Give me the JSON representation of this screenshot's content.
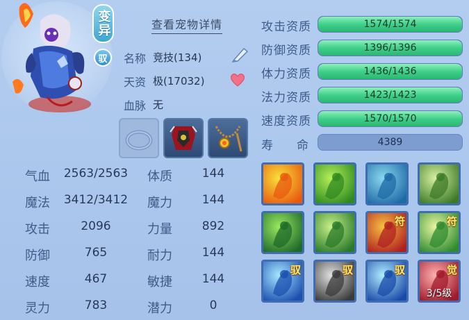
{
  "header": {
    "variant_tag": "变异",
    "tamed_tag": "驭",
    "detail_link": "查看宠物详情"
  },
  "info": {
    "name_label": "名称",
    "name_value": "竞技(134)",
    "talent_label": "天资",
    "talent_value": "极(17032)",
    "bloodline_label": "血脉",
    "bloodline_value": "无"
  },
  "equipment": [
    {
      "name": "collar-slot",
      "state": "empty"
    },
    {
      "name": "armor-slot",
      "state": "equipped"
    },
    {
      "name": "necklace-slot",
      "state": "equipped"
    }
  ],
  "attributes": [
    {
      "label": "气血",
      "value": "2563/2563",
      "label2": "体质",
      "value2": "144"
    },
    {
      "label": "魔法",
      "value": "3412/3412",
      "label2": "魔力",
      "value2": "144"
    },
    {
      "label": "攻击",
      "value": "2096",
      "label2": "力量",
      "value2": "892"
    },
    {
      "label": "防御",
      "value": "765",
      "label2": "耐力",
      "value2": "144"
    },
    {
      "label": "速度",
      "value": "467",
      "label2": "敏捷",
      "value2": "144"
    },
    {
      "label": "灵力",
      "value": "783",
      "label2": "潜力",
      "value2": "0"
    }
  ],
  "aptitudes": [
    {
      "label": "攻击资质",
      "value": "1574/1574",
      "fill": 1.0
    },
    {
      "label": "防御资质",
      "value": "1396/1396",
      "fill": 1.0
    },
    {
      "label": "体力资质",
      "value": "1436/1436",
      "fill": 1.0
    },
    {
      "label": "法力资质",
      "value": "1423/1423",
      "fill": 1.0
    },
    {
      "label": "速度资质",
      "value": "1570/1570",
      "fill": 1.0
    }
  ],
  "lifespan": {
    "label": "寿　　命",
    "value": "4389"
  },
  "skills": [
    {
      "icon": "flame-sword-icon",
      "badge": ""
    },
    {
      "icon": "green-strength-icon",
      "badge": ""
    },
    {
      "icon": "blue-spirit-icon",
      "badge": ""
    },
    {
      "icon": "moon-shadow-icon",
      "badge": ""
    },
    {
      "icon": "green-beast-icon",
      "badge": ""
    },
    {
      "icon": "green-giant-icon",
      "badge": ""
    },
    {
      "icon": "talisman-slash-icon",
      "badge": "符"
    },
    {
      "icon": "talisman-warrior-icon",
      "badge": "符"
    },
    {
      "icon": "blue-dash-icon",
      "badge": "驭"
    },
    {
      "icon": "blade-icon",
      "badge": "驭"
    },
    {
      "icon": "blue-sprint-icon",
      "badge": "驭"
    },
    {
      "icon": "awaken-icon",
      "badge": "觉",
      "level": "3/5级"
    }
  ],
  "colors": {
    "panel": "#a9c6ec",
    "aptitude_fill": "#3fd08a",
    "skill_border": "#3f6db0"
  }
}
